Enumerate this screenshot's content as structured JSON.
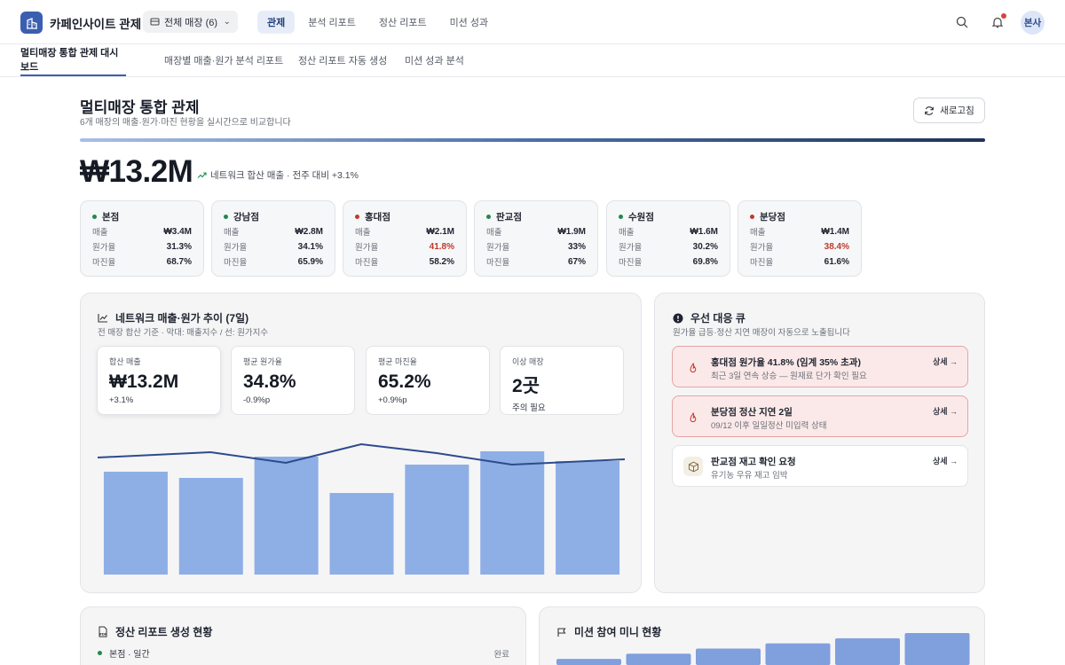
{
  "app": {
    "brand": "카페인사이트 관제",
    "store_selector": "전체 매장 (6)",
    "nav": [
      {
        "label": "관제",
        "active": true
      },
      {
        "label": "분석 리포트",
        "active": false
      },
      {
        "label": "정산 리포트",
        "active": false
      },
      {
        "label": "미션 성과",
        "active": false
      }
    ],
    "avatar": "본사"
  },
  "subtabs": [
    {
      "label": "멀티매장 통합 관제 대시보드",
      "active": true
    },
    {
      "label": "매장별 매출·원가 분석 리포트",
      "active": false
    },
    {
      "label": "정산 리포트 자동 생성",
      "active": false
    },
    {
      "label": "미션 성과 분석",
      "active": false
    }
  ],
  "header": {
    "title": "멀티매장 통합 관제",
    "subtitle": "6개 매장의 매출·원가·마진 현황을 실시간으로 비교합니다",
    "refresh_label": "새로고침"
  },
  "summary": {
    "total_revenue": "₩13.2M",
    "note": "네트워크 합산 매출 · 전주 대비 +3.1%"
  },
  "row_labels": {
    "revenue": "매출",
    "cost": "원가율",
    "margin": "마진율"
  },
  "stores": [
    {
      "name": "본점",
      "status": "good",
      "revenue": "₩3.4M",
      "cost_rate": "31.3%",
      "margin": "68.7%",
      "cost_alert": false
    },
    {
      "name": "강남점",
      "status": "good",
      "revenue": "₩2.8M",
      "cost_rate": "34.1%",
      "margin": "65.9%",
      "cost_alert": false
    },
    {
      "name": "홍대점",
      "status": "alert",
      "revenue": "₩2.1M",
      "cost_rate": "41.8%",
      "margin": "58.2%",
      "cost_alert": true
    },
    {
      "name": "판교점",
      "status": "good",
      "revenue": "₩1.9M",
      "cost_rate": "33%",
      "margin": "67%",
      "cost_alert": false
    },
    {
      "name": "수원점",
      "status": "good",
      "revenue": "₩1.6M",
      "cost_rate": "30.2%",
      "margin": "69.8%",
      "cost_alert": false
    },
    {
      "name": "분당점",
      "status": "alert",
      "revenue": "₩1.4M",
      "cost_rate": "38.4%",
      "margin": "61.6%",
      "cost_alert": true
    }
  ],
  "colors": {
    "good": "#1e8a4c",
    "alert": "#c0392b",
    "bar": "#8eaee6",
    "line": "#2c4b8c",
    "accent": "#3b5fb0"
  },
  "trend": {
    "title": "네트워크 매출·원가 추이 (7일)",
    "subtitle": "전 매장 합산 기준 · 막대: 매출지수 / 선: 원가지수",
    "kpis": [
      {
        "label": "합산 매출",
        "value": "₩13.2M",
        "delta": "+3.1%"
      },
      {
        "label": "평균 원가율",
        "value": "34.8%",
        "delta": "-0.9%p"
      },
      {
        "label": "평균 마진율",
        "value": "65.2%",
        "delta": "+0.9%p"
      },
      {
        "label": "이상 매장",
        "value": "2곳",
        "delta": "주의 필요"
      }
    ]
  },
  "chart_data": {
    "type": "bar",
    "series": [
      {
        "values": [
          116,
          109,
          133,
          92,
          124,
          139,
          128
        ]
      },
      {
        "values": [
          132,
          138,
          126,
          147,
          137,
          124,
          130
        ]
      }
    ]
  },
  "queue": {
    "title": "우선 대응 큐",
    "subtitle": "원가율 급등·정산 지연 매장이 자동으로 노출됩니다",
    "items": [
      {
        "title": "홍대점 원가율 41.8% (임계 35% 초과)",
        "desc": "최근 3일 연속 상승 — 원재료 단가 확인 필요",
        "more": "상세 →",
        "level": "danger",
        "icon": "fire-icon"
      },
      {
        "title": "분당점 정산 지연 2일",
        "desc": "09/12 이후 일일정산 미입력 상태",
        "more": "상세 →",
        "level": "danger",
        "icon": "fire-icon"
      },
      {
        "title": "판교점 재고 확인 요청",
        "desc": "유기농 우유 재고 임박",
        "more": "상세 →",
        "level": "normal",
        "icon": "box-icon"
      }
    ]
  },
  "report": {
    "title": "정산 리포트 생성 현황",
    "rows": [
      {
        "label": "본점 · 일간",
        "status": "완료"
      }
    ]
  },
  "mission": {
    "title": "미션 참여 미니 현황",
    "values": [
      1,
      3,
      5,
      7,
      9,
      11
    ]
  }
}
